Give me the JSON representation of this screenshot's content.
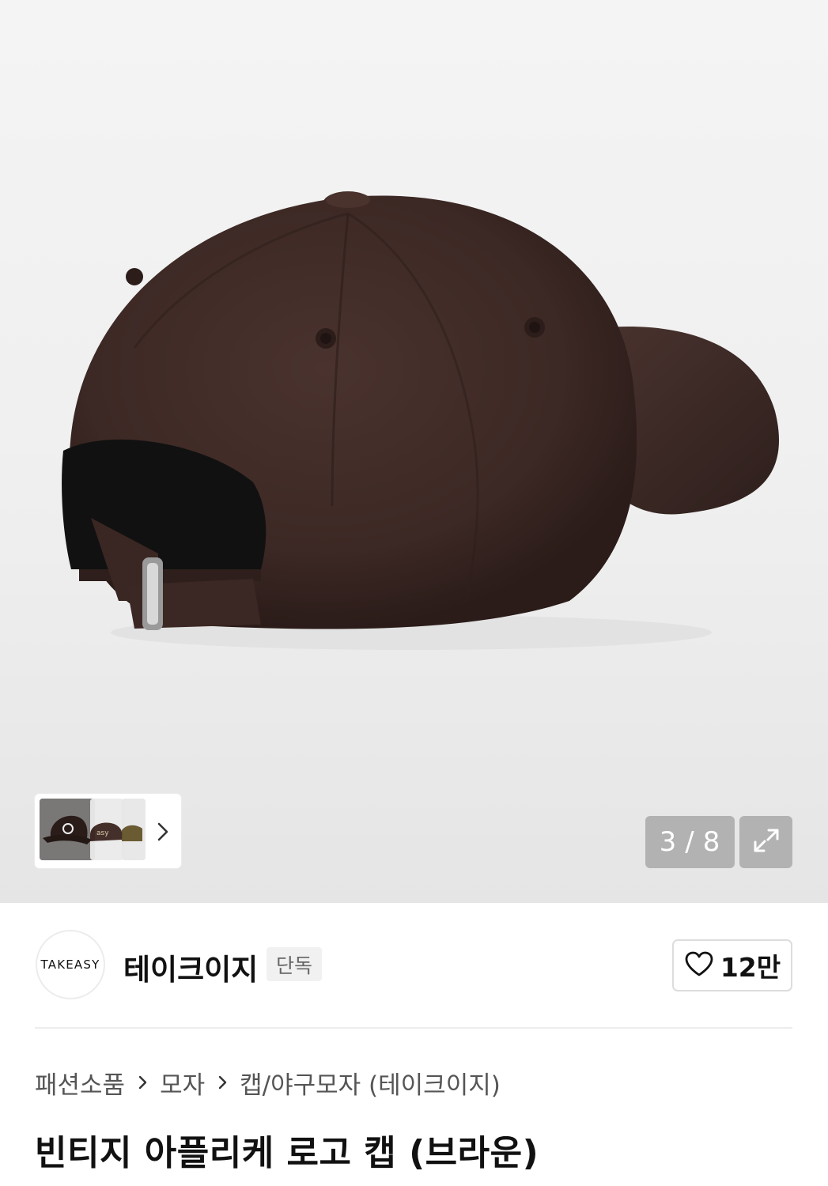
{
  "gallery": {
    "counter_current": "3",
    "counter_sep": "/",
    "counter_total": "8",
    "expand_icon": "expand-arrows-icon",
    "next_icon": "chevron-right-icon",
    "product_color": "#3f2a26"
  },
  "brand": {
    "logo_text": "TAKEASY",
    "name": "테이크이지",
    "badge": "단독",
    "like_count": "12만",
    "like_icon": "heart-outline-icon"
  },
  "breadcrumb": {
    "items": [
      "패션소품",
      "모자",
      "캡/야구모자 (테이크이지)"
    ]
  },
  "product": {
    "title": "빈티지 아플리케 로고 캡 (브라운)"
  }
}
